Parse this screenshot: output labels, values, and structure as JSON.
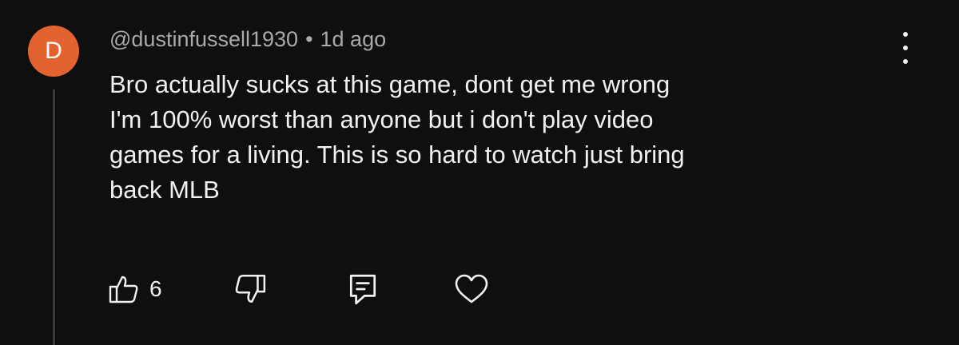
{
  "comment": {
    "avatar_letter": "D",
    "avatar_color": "#e2632f",
    "username": "@dustinfussell1930",
    "separator": "•",
    "time_ago": "1d ago",
    "text_lines": [
      "Bro actually sucks at this game, dont get me wrong",
      "I'm 100% worst than anyone but i don't play video",
      "games for a living. This is so hard to watch just bring",
      "back MLB"
    ]
  },
  "actions": {
    "like_count": "6",
    "icons": [
      "thumbs-up-icon",
      "thumbs-down-icon",
      "reply-icon",
      "heart-icon",
      "more-vert-icon"
    ]
  },
  "colors": {
    "background": "#0f0f0f",
    "text_primary": "#f1f1f1",
    "text_secondary": "#aaaaaa",
    "thread_line": "#3a3a3a"
  }
}
